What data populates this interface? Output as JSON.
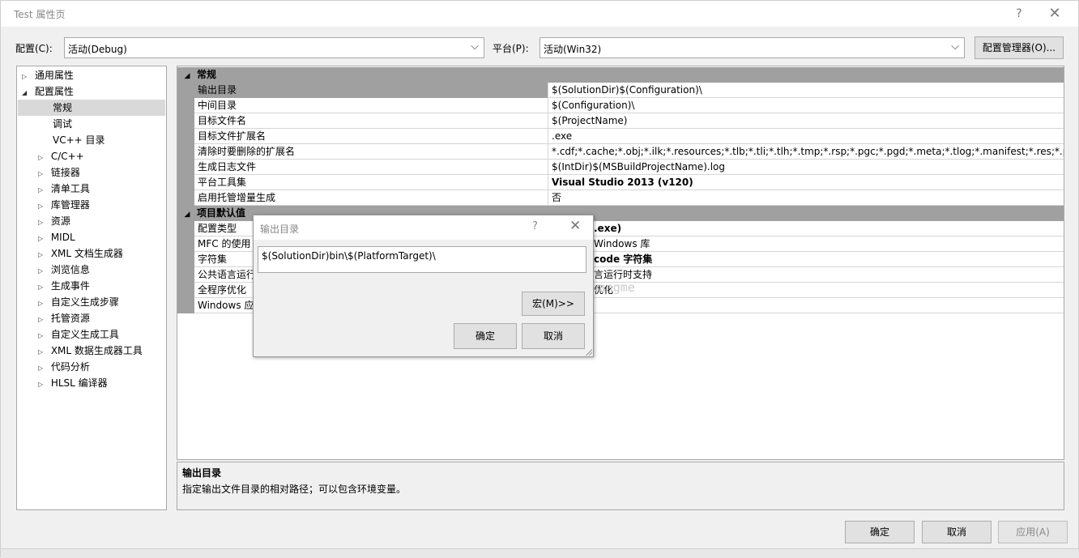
{
  "window": {
    "title": "Test 属性页",
    "help_glyph": "?",
    "close_glyph": "✕"
  },
  "config_bar": {
    "config_label": "配置(C):",
    "config_value": "活动(Debug)",
    "platform_label": "平台(P):",
    "platform_value": "活动(Win32)",
    "manager_button": "配置管理器(O)...",
    "dropdown_glyph": "⌵"
  },
  "tree": {
    "items": [
      {
        "label": "通用属性",
        "expander": "▷"
      },
      {
        "label": "配置属性",
        "expander": "◢"
      },
      {
        "label": "常规",
        "expander": ""
      },
      {
        "label": "调试",
        "expander": ""
      },
      {
        "label": "VC++ 目录",
        "expander": ""
      },
      {
        "label": "C/C++",
        "expander": "▷"
      },
      {
        "label": "链接器",
        "expander": "▷"
      },
      {
        "label": "清单工具",
        "expander": "▷"
      },
      {
        "label": "库管理器",
        "expander": "▷"
      },
      {
        "label": "资源",
        "expander": "▷"
      },
      {
        "label": "MIDL",
        "expander": "▷"
      },
      {
        "label": "XML 文档生成器",
        "expander": "▷"
      },
      {
        "label": "浏览信息",
        "expander": "▷"
      },
      {
        "label": "生成事件",
        "expander": "▷"
      },
      {
        "label": "自定义生成步骤",
        "expander": "▷"
      },
      {
        "label": "托管资源",
        "expander": "▷"
      },
      {
        "label": "自定义生成工具",
        "expander": "▷"
      },
      {
        "label": "XML 数据生成器工具",
        "expander": "▷"
      },
      {
        "label": "代码分析",
        "expander": "▷"
      },
      {
        "label": "HLSL 编译器",
        "expander": "▷"
      }
    ]
  },
  "grid": {
    "general": {
      "category": "常规",
      "expander": "◢",
      "rows": [
        {
          "name": "输出目录",
          "value": "$(SolutionDir)$(Configuration)\\"
        },
        {
          "name": "中间目录",
          "value": "$(Configuration)\\"
        },
        {
          "name": "目标文件名",
          "value": "$(ProjectName)"
        },
        {
          "name": "目标文件扩展名",
          "value": ".exe"
        },
        {
          "name": "清除时要删除的扩展名",
          "value": "*.cdf;*.cache;*.obj;*.ilk;*.resources;*.tlb;*.tli;*.tlh;*.tmp;*.rsp;*.pgc;*.pgd;*.meta;*.tlog;*.manifest;*.res;*.pch;*.exp;*"
        },
        {
          "name": "生成日志文件",
          "value": "$(IntDir)$(MSBuildProjectName).log"
        },
        {
          "name": "平台工具集",
          "value": "Visual Studio 2013 (v120)"
        },
        {
          "name": "启用托管增量生成",
          "value": "否"
        }
      ]
    },
    "defaults": {
      "category": "项目默认值",
      "expander": "◢",
      "rows": [
        {
          "name": "配置类型",
          "value": ".exe)"
        },
        {
          "name": "MFC 的使用",
          "value": "Windows 库"
        },
        {
          "name": "字符集",
          "value": "code 字符集"
        },
        {
          "name": "公共语言运行",
          "value": "言运行时支持"
        },
        {
          "name": "全程序优化",
          "value": "优化"
        },
        {
          "name": "Windows 应",
          "value": ""
        }
      ]
    }
  },
  "description": {
    "title": "输出目录",
    "text": "指定输出文件目录的相对路径；可以包含环境变量。"
  },
  "footer": {
    "ok": "确定",
    "cancel": "取消",
    "apply": "应用(A)"
  },
  "dialog": {
    "title": "输出目录",
    "help_glyph": "?",
    "close_glyph": "✕",
    "input_value": "$(SolutionDir)bin\\$(PlatformTarget)\\",
    "macro_button": "宏(M)>>",
    "ok": "确定",
    "cancel": "取消"
  },
  "watermark": "http://blog.csdn.net/kwangme"
}
